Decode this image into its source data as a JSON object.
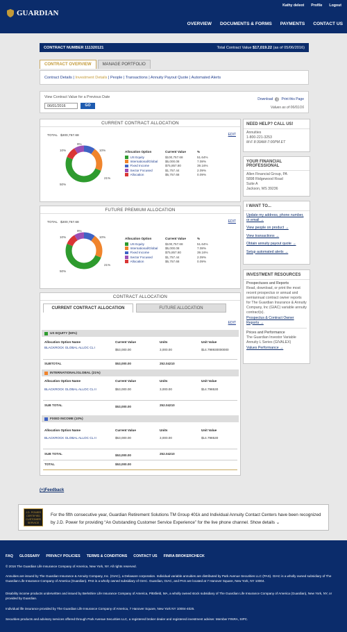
{
  "header": {
    "logo": "GUARDIAN",
    "user": "Kathy deleot",
    "profile": "Profile",
    "logout": "Logout",
    "nav": [
      "OVERVIEW",
      "DOCUMENTS & FORMS",
      "PAYMENTS",
      "CONTACT US"
    ]
  },
  "contract": {
    "number_label": "CONTRACT NUMBER 111320121",
    "value_label": "Total Contract Value",
    "value": "$17,019.22",
    "asof": "(as of 05/06/2016)"
  },
  "tabs": [
    "CONTRACT OVERVIEW",
    "MANAGE PORTFOLIO"
  ],
  "subnav": {
    "items": [
      "Contract Details",
      "Investment Details",
      "People",
      "Transactions",
      "Annuity Payout Quote",
      "Automated Alerts"
    ],
    "sep": " | "
  },
  "valuebox": {
    "label": "View Contract Value for a Previous Date",
    "date": "06/01/2016",
    "go": "GO",
    "download": "Download",
    "print": "Print this Page",
    "asof": "Values as of 06/01/16"
  },
  "colors": {
    "navy": "#0b2c6b",
    "gold": "#c39a38",
    "green": "#2e9b2e",
    "orange": "#f0842c",
    "blue": "#3f63c4",
    "purple": "#9b4fb5",
    "red": "#d93535"
  },
  "current_alloc": {
    "title": "CURRENT CONTRACT ALLOCATION",
    "edit": "EDIT",
    "total_label": "TOTAL",
    "total": "$200,757.68",
    "labels": {
      "top": "9%",
      "tl": "10%",
      "tr": "10%",
      "bl": "50%",
      "br": "21%"
    },
    "headers": [
      "Allocation Option",
      "Current Value",
      "%"
    ],
    "rows": [
      {
        "name": "US Equity",
        "value": "$100,757.68",
        "pct": "51.64%"
      },
      {
        "name": "International/Global",
        "value": "$5,000.08",
        "pct": "7.08%"
      },
      {
        "name": "Fixed Income",
        "value": "$75,857.80",
        "pct": "39.16%"
      },
      {
        "name": "Sector Focused",
        "value": "$1,757.44",
        "pct": "2.09%"
      },
      {
        "name": "Allocation",
        "value": "$5,757.68",
        "pct": "0.09%"
      }
    ]
  },
  "future_alloc": {
    "title": "FUTURE PREMIUM ALLOCATION",
    "edit": "EDIT",
    "total_label": "TOTAL",
    "total": "$200,757.68",
    "labels": {
      "top": "9%",
      "tl": "10%",
      "tr": "10%",
      "bl": "50%",
      "br": "21%"
    },
    "headers": [
      "Allocation Option",
      "Current Value",
      "%"
    ],
    "rows": [
      {
        "name": "US Equity",
        "value": "$100,757.68",
        "pct": "51.64%"
      },
      {
        "name": "International/Global",
        "value": "$5,000.08",
        "pct": "7.08%"
      },
      {
        "name": "Fixed Income",
        "value": "$75,857.80",
        "pct": "39.16%"
      },
      {
        "name": "Sector Focused",
        "value": "$1,757.44",
        "pct": "2.09%"
      },
      {
        "name": "Allocation",
        "value": "$5,757.68",
        "pct": "0.09%"
      }
    ]
  },
  "contract_alloc": {
    "title": "CONTRACT ALLOCATION",
    "tabs": [
      "CURRENT CONTRACT ALLOCATION",
      "FUTURE ALLOCATION"
    ],
    "edit": "EDIT",
    "headers": [
      "Allocation Option Name",
      "Current Value",
      "Units",
      "Unit Value"
    ],
    "sections": [
      {
        "title": "US EQUITY (50%)",
        "fund": "BLACKROCK GLOBAL ALLOC CL I",
        "value": "$53,000.00",
        "units": "3,000.00",
        "unit_value": "$14.798930000000",
        "total_label": "SUBTOTAL",
        "total_value": "$53,000.00",
        "total_units": "252.04210"
      },
      {
        "title": "INTERNATIONAL/GLOBAL (21%)",
        "fund": "BLACKROCK GLOBAL ALLOC CL II",
        "value": "$53,000.00",
        "units": "3,000.00",
        "unit_value": "$14.798530",
        "total_label": "SUB TOTAL",
        "total_value": "$53,000.00",
        "total_units": "252.04210"
      },
      {
        "title": "FIXED INCOME (10%)",
        "fund": "BLACKROCK GLOBAL ALLOC CL II",
        "value": "$53,000.00",
        "units": "3,000.00",
        "unit_value": "$14.798530",
        "total_label": "SUB TOTAL",
        "total_value": "$53,000.00",
        "total_units": "252.04210"
      }
    ],
    "grand_total_label": "TOTAL",
    "grand_total": "$53,000.00"
  },
  "help": {
    "title": "NEED HELP? CALL US!",
    "line1": "Annuities",
    "phone": "1-800-221-3253",
    "hours": "M-F 8:30AM-7:00PM ET"
  },
  "professional": {
    "title": "YOUR FINANCIAL PROFESSIONAL",
    "name": "Allen Financial Group, PA",
    "addr1": "5898 Ridgewood Road",
    "addr2": "Suite A",
    "addr3": "Jackson, MS 39236"
  },
  "iwant": {
    "title": "I WANT TO...",
    "links": [
      "Update my address, phone number, or email →",
      "View people on product →",
      "View transactions →",
      "Obtain annuity payout quote →",
      "Setup automated alerts →"
    ]
  },
  "resources": {
    "title": "INVESTMENT RESOURCES",
    "h1": "Prospectuses and Reports",
    "t1": "Read, download, or print the most recent prospectus or annual and semiannual contract owner reports for The Guardian Insurance & Annuity Company, Inc (GIAC) variable annuity contract(s).",
    "l1": "Prospectus & Contract Owner Reports →",
    "h2": "Prices and Performance",
    "t2": "The Guardian Investor Variable Annuity L Series (GIVALEX)",
    "l2": "Values Performance →"
  },
  "feedback": "(+)Feedback",
  "banner": {
    "award": "J.D. POWER CERTIFIED CUSTOMER SERVICE",
    "text": "For the fifth consecutive year, Guardian Retirement Solutions TM Group 401k and Individual Annuity Contact Centers have been recognized by J.D. Power for providing “An Outstanding Customer Service Experience” for the live phone channel. Show details ⌄"
  },
  "footer": {
    "links": [
      "FAQ",
      "GLOSSARY",
      "PRIVACY POLICIES",
      "TERMS & CONDITIONS",
      "CONTACT US",
      "FINRA BROKERCHECK"
    ],
    "copyright": "© 2016 The Guardian Life Insurance Company of America, New York, NY. All rights reserved.",
    "p1": "Annuities are issued by The Guardian Insurance & Annuity Company, Inc. (GIAC), a Delaware corporation. Individual variable annuities are distributed by Park Avenue Securities LLC (PAS). GIAC is a wholly owned subsidiary of The Guardian Life Insurance Company of America (Guardian). PAS is a wholly owned subsidiary of GIAC. Guardian, GIAC, and PAS are located at 7 Hanover Square, New York, NY 10004.",
    "p2": "Disability income products underwritten and issued by Berkshire Life Insurance Company of America, Pittsfield, MA, a wholly owned stock subsidiary of The Guardian Life Insurance Company of America (Guardian), New York, NY, or provided by Guardian.",
    "p3": "Individual life insurance provided by The Guardian Life Insurance Company of America, 7 Hanover Square, New York NY 10004-4025.",
    "p4": "Securities products and advisory services offered through Park Avenue Securities LLC, a registered broker dealer and registered investment adviser. Member FINRA, SIPC."
  },
  "chart_data": [
    {
      "type": "pie",
      "title": "CURRENT CONTRACT ALLOCATION",
      "categories": [
        "US Equity",
        "International/Global",
        "Fixed Income",
        "Sector Focused",
        "Allocation"
      ],
      "values": [
        50,
        21,
        10,
        9,
        10
      ]
    },
    {
      "type": "pie",
      "title": "FUTURE PREMIUM ALLOCATION",
      "categories": [
        "US Equity",
        "International/Global",
        "Fixed Income",
        "Sector Focused",
        "Allocation"
      ],
      "values": [
        50,
        21,
        10,
        9,
        10
      ]
    }
  ]
}
